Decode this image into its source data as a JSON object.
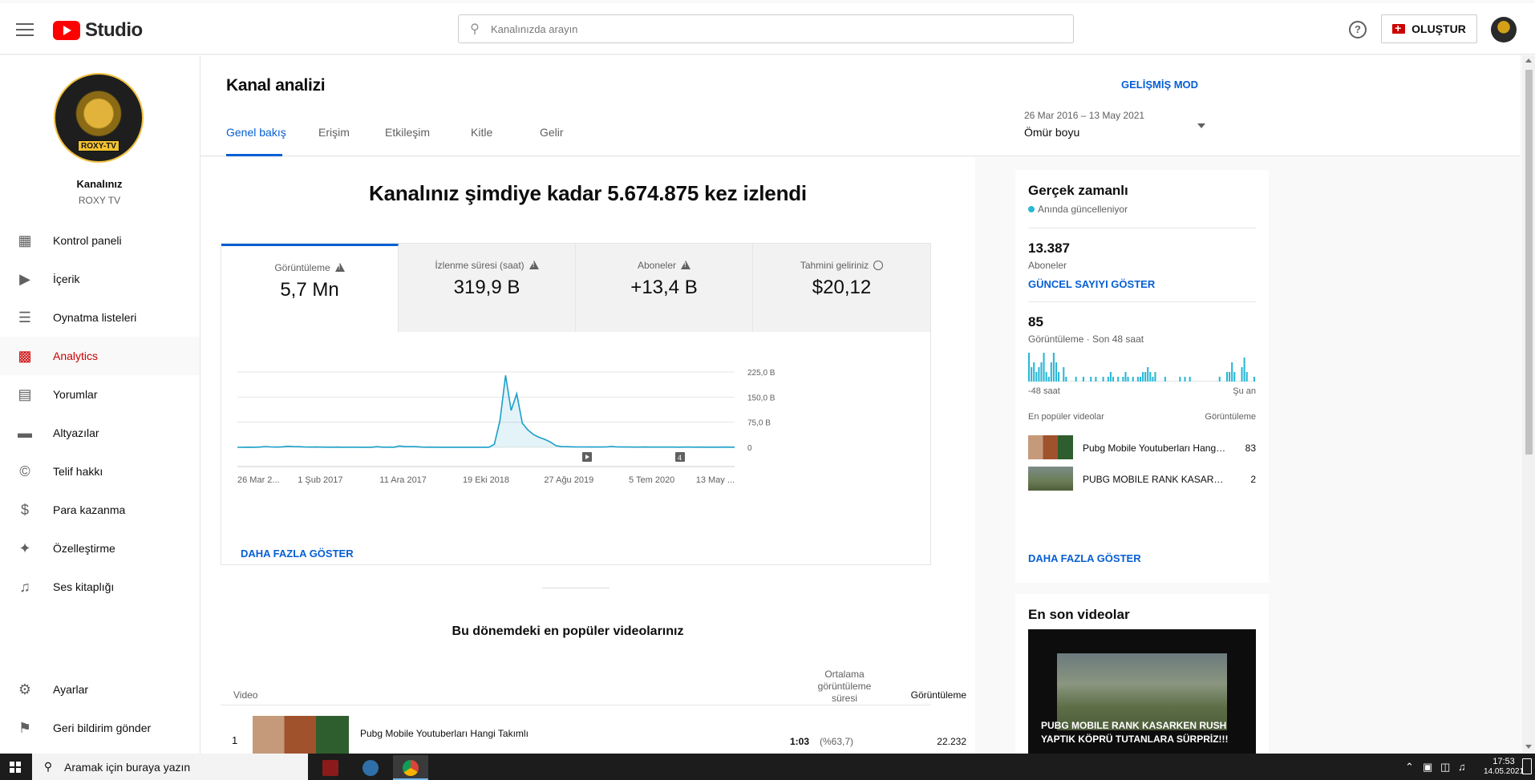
{
  "topbar": {
    "logo_text": "Studio",
    "search_placeholder": "Kanalınızda arayın",
    "create_label": "OLUŞTUR"
  },
  "sidebar": {
    "channel_badge": "ROXY-TV",
    "channel_label": "Kanalınız",
    "channel_name": "ROXY TV",
    "items": [
      {
        "label": "Kontrol paneli",
        "icon": "dashboard-icon"
      },
      {
        "label": "İçerik",
        "icon": "content-icon"
      },
      {
        "label": "Oynatma listeleri",
        "icon": "playlist-icon"
      },
      {
        "label": "Analytics",
        "icon": "analytics-icon"
      },
      {
        "label": "Yorumlar",
        "icon": "comments-icon"
      },
      {
        "label": "Altyazılar",
        "icon": "subtitles-icon"
      },
      {
        "label": "Telif hakkı",
        "icon": "copyright-icon"
      },
      {
        "label": "Para kazanma",
        "icon": "dollar-icon"
      },
      {
        "label": "Özelleştirme",
        "icon": "magic-wand-icon"
      },
      {
        "label": "Ses kitaplığı",
        "icon": "audio-library-icon"
      }
    ],
    "settings_label": "Ayarlar",
    "feedback_label": "Geri bildirim gönder"
  },
  "header": {
    "title": "Kanal analizi",
    "advanced_mode": "GELİŞMİŞ MOD",
    "tabs": [
      "Genel bakış",
      "Erişim",
      "Etkileşim",
      "Kitle",
      "Gelir"
    ],
    "date_range": "26 Mar 2016 – 13 May 2021",
    "period": "Ömür boyu"
  },
  "overview": {
    "headline": "Kanalınız şimdiye kadar 5.674.875 kez izlendi",
    "metrics": [
      {
        "label": "Görüntüleme",
        "value": "5,7 Mn"
      },
      {
        "label": "İzlenme süresi (saat)",
        "value": "319,9 B"
      },
      {
        "label": "Aboneler",
        "value": "+13,4 B"
      },
      {
        "label": "Tahmini geliriniz",
        "value": "$20,12"
      }
    ],
    "show_more": "DAHA FAZLA GÖSTER"
  },
  "chart_data": {
    "type": "line",
    "title": "",
    "xlabel": "",
    "ylabel": "",
    "x_ticks": [
      "26 Mar 2...",
      "1 Şub 2017",
      "11 Ara 2017",
      "19 Eki 2018",
      "27 Ağu 2019",
      "5 Tem 2020",
      "13 May ..."
    ],
    "y_ticks": [
      "225,0 B",
      "150,0 B",
      "75,0 B",
      "0"
    ],
    "ylim": [
      0,
      225000
    ],
    "grid": true,
    "series": [
      {
        "values": [
          0,
          200,
          400,
          300,
          800,
          2500,
          1200,
          600,
          1500,
          3000,
          2200,
          1800,
          900,
          600,
          1000,
          700,
          500,
          400,
          600,
          300,
          400,
          500,
          300,
          200,
          300,
          1800,
          500,
          400,
          300,
          4000,
          1800,
          2500,
          2000,
          600,
          500,
          400,
          300,
          350,
          300,
          250,
          300,
          250,
          300,
          200,
          250,
          300,
          9000,
          80000,
          215000,
          110000,
          160000,
          72000,
          52000,
          38000,
          30000,
          24000,
          16000,
          5000,
          2200,
          1800,
          1500,
          1300,
          1200,
          1000,
          1100,
          900,
          1200,
          2600,
          1200,
          1000,
          900,
          800,
          700,
          900,
          700,
          600,
          800,
          700,
          600,
          500,
          600,
          700,
          500,
          600,
          500,
          400,
          500,
          600,
          400,
          500
        ]
      }
    ],
    "markers": [
      "play-marker",
      "4"
    ]
  },
  "top_videos": {
    "title": "Bu dönemdeki en popüler videolarınız",
    "col_video": "Video",
    "col_avg": "Ortalama görüntüleme süresi",
    "col_views": "Görüntüleme",
    "rows": [
      {
        "rank": "1",
        "title": "Pubg Mobile Youtuberları Hangi Takımlı",
        "avg": "1:03",
        "pct": "(%63,7)",
        "views": "22.232"
      }
    ]
  },
  "realtime": {
    "title": "Gerçek zamanlı",
    "subtitle": "Anında güncelleniyor",
    "subs_value": "13.387",
    "subs_label": "Aboneler",
    "show_count": "GÜNCEL SAYIYI GÖSTER",
    "views_value": "85",
    "views_label": "Görüntüleme · Son 48 saat",
    "axis_start": "-48 saat",
    "axis_end": "Şu an",
    "bars": [
      6,
      3,
      4,
      2,
      3,
      4,
      6,
      2,
      1,
      4,
      6,
      4,
      2,
      0,
      3,
      1,
      0,
      0,
      0,
      1,
      0,
      0,
      1,
      0,
      0,
      1,
      0,
      1,
      0,
      0,
      1,
      0,
      1,
      2,
      1,
      0,
      1,
      0,
      1,
      2,
      1,
      0,
      1,
      0,
      1,
      1,
      2,
      2,
      3,
      2,
      1,
      2,
      0,
      0,
      0,
      1,
      0,
      0,
      0,
      0,
      0,
      1,
      0,
      1,
      0,
      1,
      0,
      0,
      0,
      0,
      0,
      0,
      0,
      0,
      0,
      0,
      0,
      1,
      0,
      0,
      2,
      2,
      4,
      2,
      0,
      0,
      3,
      5,
      2,
      0,
      0,
      1
    ],
    "top_label": "En popüler videolar",
    "top_views_label": "Görüntüleme",
    "videos": [
      {
        "title": "Pubg Mobile Youtuberları Hangi Takımlı",
        "count": "83"
      },
      {
        "title": "PUBG MOBILE RANK KASARKEN RUSH YAPTIK",
        "count": "2"
      }
    ],
    "show_more": "DAHA FAZLA GÖSTER"
  },
  "latest": {
    "title": "En son videolar",
    "video_title": "PUBG MOBILE RANK KASARKEN RUSH YAPTIK KÖPRÜ TUTANLARA SÜRPRİZ!!!"
  },
  "taskbar": {
    "search_placeholder": "Aramak için buraya yazın",
    "time": "17:53",
    "date": "14.05.2021"
  },
  "colors": {
    "accent": "#065fd4",
    "brand": "#ff0000",
    "chart_line": "#1a9ec9",
    "realtime_bar": "#2bb7d6"
  }
}
